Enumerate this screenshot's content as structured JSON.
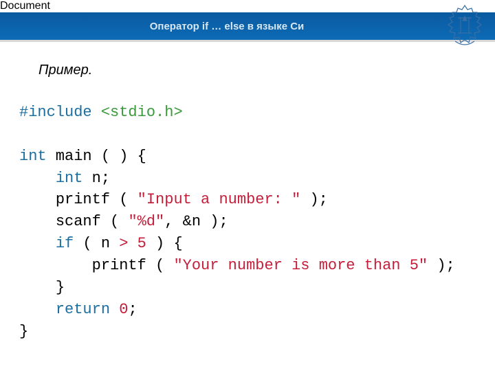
{
  "header": {
    "title": "Оператор if … else в языке Си"
  },
  "example_label": "Пример.",
  "code": {
    "l1": {
      "inc": "#include",
      "lt": "<",
      "hdr": "stdio.h",
      "gt": ">"
    },
    "l2": {
      "kw1": "int",
      "fn": " main ( ) {"
    },
    "l3": {
      "indent": "    ",
      "kw": "int",
      "rest": " n;"
    },
    "l4": {
      "indent": "    ",
      "fn": "printf ( ",
      "str": "\"Input a number: \"",
      "rest": " );"
    },
    "l5": {
      "indent": "    ",
      "fn": "scanf ( ",
      "str": "\"%d\"",
      "rest": ", &n );"
    },
    "l6": {
      "indent": "    ",
      "kw": "if",
      "pre": " ( n ",
      "op": ">",
      "sp": " ",
      "num": "5",
      "post": " ) {"
    },
    "l7": {
      "indent": "        ",
      "fn": "printf ( ",
      "str": "\"Your number is more than 5\"",
      "rest": " );"
    },
    "l8": {
      "indent": "    ",
      "brace": "}"
    },
    "l9": {
      "indent": "    ",
      "kw": "return",
      "sp": " ",
      "num": "0",
      "semi": ";"
    },
    "l10": {
      "brace": "}"
    }
  }
}
